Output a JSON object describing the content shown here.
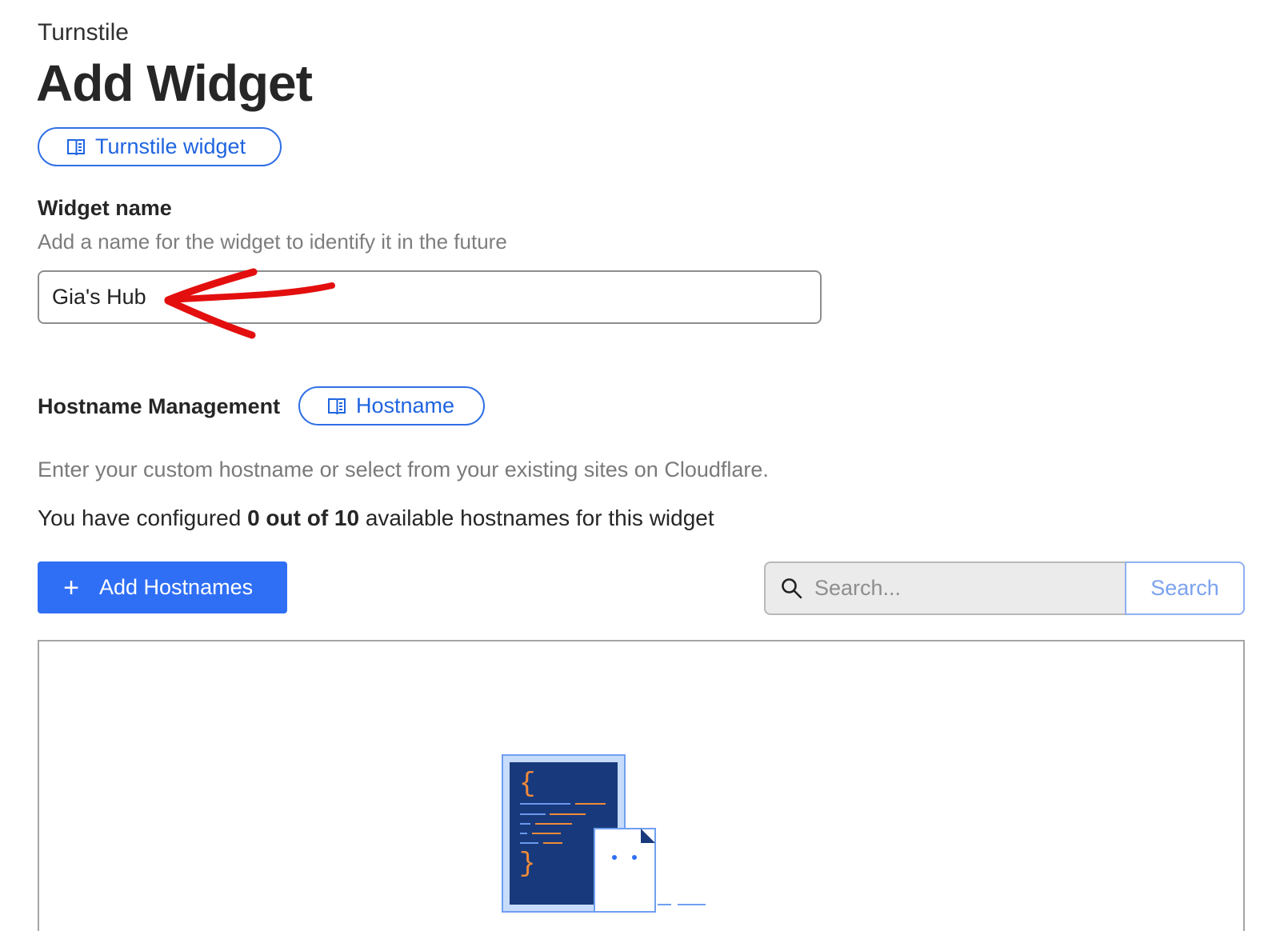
{
  "header": {
    "eyebrow": "Turnstile",
    "title": "Add Widget",
    "doc_link_label": "Turnstile widget",
    "doc_link_icon": "book-open-icon"
  },
  "widget_name": {
    "label": "Widget name",
    "helper": "Add a name for the widget to identify it in the future",
    "value": "Gia's Hub",
    "annotation": "red-arrow-icon",
    "annotation_color": "#e30f0f"
  },
  "hostname": {
    "label": "Hostname Management",
    "doc_link_label": "Hostname",
    "doc_link_icon": "book-open-icon",
    "description": "Enter your custom hostname or select from your existing sites on Cloudflare.",
    "config_prefix": "You have configured ",
    "config_count": "0 out of 10",
    "config_suffix": " available hostnames for this widget"
  },
  "actions": {
    "add_button_label": "Add Hostnames",
    "add_button_icon": "plus-icon",
    "search_icon": "search-icon",
    "search_placeholder": "Search...",
    "search_button_label": "Search"
  },
  "colors": {
    "accent": "#2f6ff5",
    "link": "#1f64e0",
    "illustration_navy": "#183a7d",
    "illustration_orange": "#f28b38"
  },
  "empty_state": {
    "illustration": "code-document-illustration"
  }
}
